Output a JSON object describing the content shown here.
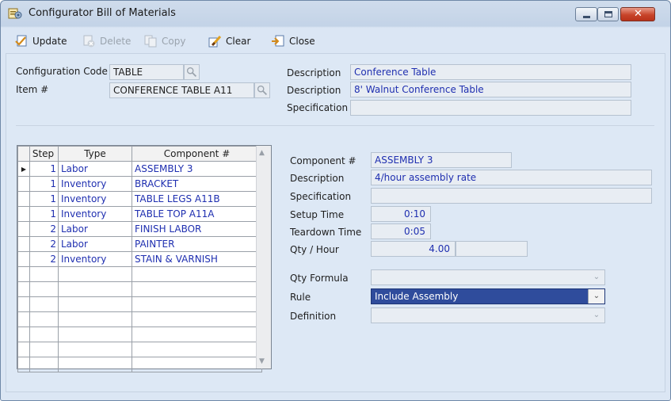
{
  "window": {
    "title": "Configurator Bill of Materials",
    "icon": "configurator-app-icon",
    "caption_buttons": [
      "minimize",
      "maximize",
      "close"
    ]
  },
  "toolbar": {
    "update": {
      "label": "Update",
      "icon": "update-icon",
      "enabled": true
    },
    "delete": {
      "label": "Delete",
      "icon": "delete-icon",
      "enabled": false
    },
    "copy": {
      "label": "Copy",
      "icon": "copy-icon",
      "enabled": false
    },
    "clear": {
      "label": "Clear",
      "icon": "clear-icon",
      "enabled": true
    },
    "close": {
      "label": "Close",
      "icon": "close-doc-icon",
      "enabled": true
    }
  },
  "header": {
    "configuration_code_label": "Configuration Code",
    "configuration_code": "TABLE",
    "item_label": "Item #",
    "item": "CONFERENCE TABLE A11",
    "description_label": "Description",
    "description1": "Conference Table",
    "description2_label": "Description",
    "description2": "8' Walnut Conference Table",
    "specification_label": "Specification",
    "specification": ""
  },
  "grid": {
    "columns": [
      "Step",
      "Type",
      "Component #"
    ],
    "rows": [
      {
        "step": "1",
        "type": "Labor",
        "component": "ASSEMBLY 3",
        "current": true
      },
      {
        "step": "1",
        "type": "Inventory",
        "component": "BRACKET"
      },
      {
        "step": "1",
        "type": "Inventory",
        "component": "TABLE LEGS A11B"
      },
      {
        "step": "1",
        "type": "Inventory",
        "component": "TABLE TOP A11A"
      },
      {
        "step": "2",
        "type": "Labor",
        "component": "FINISH LABOR"
      },
      {
        "step": "2",
        "type": "Labor",
        "component": "PAINTER"
      },
      {
        "step": "2",
        "type": "Inventory",
        "component": "STAIN & VARNISH"
      },
      {
        "step": "",
        "type": "",
        "component": ""
      },
      {
        "step": "",
        "type": "",
        "component": ""
      },
      {
        "step": "",
        "type": "",
        "component": ""
      },
      {
        "step": "",
        "type": "",
        "component": ""
      },
      {
        "step": "",
        "type": "",
        "component": ""
      },
      {
        "step": "",
        "type": "",
        "component": ""
      },
      {
        "step": "",
        "type": "",
        "component": ""
      }
    ]
  },
  "detail": {
    "component_label": "Component #",
    "component": "ASSEMBLY 3",
    "description_label": "Description",
    "description": "4/hour assembly rate",
    "specification_label": "Specification",
    "specification": "",
    "setup_time_label": "Setup Time",
    "setup_time": "0:10",
    "teardown_time_label": "Teardown Time",
    "teardown_time": "0:05",
    "qty_hour_label": "Qty / Hour",
    "qty_hour": "4.00",
    "qty_hour_unit": "",
    "qty_formula_label": "Qty Formula",
    "qty_formula": "",
    "rule_label": "Rule",
    "rule": "Include Assembly",
    "definition_label": "Definition",
    "definition": ""
  },
  "colors": {
    "window_bg": "#dbe6f4",
    "value_text": "#1f2fb0",
    "selection": "#2f4c9c"
  }
}
